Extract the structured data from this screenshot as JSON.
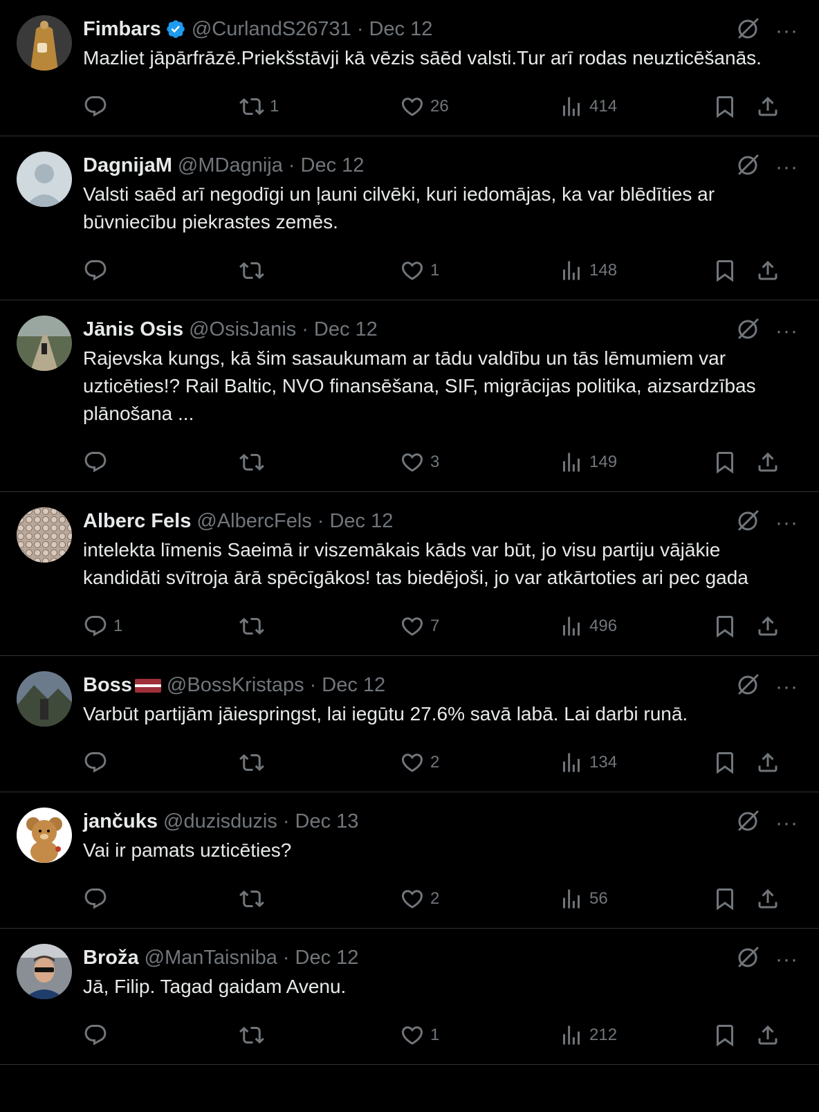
{
  "tweets": [
    {
      "name": "Fimbars",
      "verified": true,
      "flag": false,
      "handle": "@CurlandS26731",
      "date": "Dec 12",
      "text": "Mazliet jāpārfrāzē.Priekšstāvji kā vēzis sāēd valsti.Tur arī rodas neuzticēšanās.",
      "replies": "",
      "retweets": "1",
      "likes": "26",
      "views": "414",
      "avatar": "fimbars"
    },
    {
      "name": "DagnijaM",
      "verified": false,
      "flag": false,
      "handle": "@MDagnija",
      "date": "Dec 12",
      "text": "Valsti saēd arī negodīgi un ļauni cilvēki, kuri iedomājas, ka var blēdīties ar būvniecību piekrastes zemēs.",
      "replies": "",
      "retweets": "",
      "likes": "1",
      "views": "148",
      "avatar": "default"
    },
    {
      "name": "Jānis Osis",
      "verified": false,
      "flag": false,
      "handle": "@OsisJanis",
      "date": "Dec 12",
      "text": "Rajevska kungs, kā šim sasaukumam ar tādu valdību un tās lēmumiem var uzticēties!? Rail Baltic, NVO finansēšana, SIF, migrācijas politika, aizsardzības plānošana ...",
      "replies": "",
      "retweets": "",
      "likes": "3",
      "views": "149",
      "avatar": "road"
    },
    {
      "name": "Alberc Fels",
      "verified": false,
      "flag": false,
      "handle": "@AlbercFels",
      "date": "Dec 12",
      "text": "intelekta līmenis Saeimā ir viszemākais kāds var būt, jo visu partiju vājākie kandidāti svītroja ārā spēcīgākos! tas biedējoši, jo var atkārtoties ari pec gada",
      "replies": "1",
      "retweets": "",
      "likes": "7",
      "views": "496",
      "avatar": "tiles"
    },
    {
      "name": "Boss",
      "verified": false,
      "flag": true,
      "handle": "@BossKristaps",
      "date": "Dec 12",
      "text": "Varbūt partijām jāiespringst, lai iegūtu 27.6% savā labā. Lai darbi runā.",
      "replies": "",
      "retweets": "",
      "likes": "2",
      "views": "134",
      "avatar": "mountain"
    },
    {
      "name": "jančuks",
      "verified": false,
      "flag": false,
      "handle": "@duzisduzis",
      "date": "Dec 13",
      "text": "Vai ir pamats uzticēties?",
      "replies": "",
      "retweets": "",
      "likes": "2",
      "views": "56",
      "avatar": "teddy"
    },
    {
      "name": "Broža",
      "verified": false,
      "flag": false,
      "handle": "@ManTaisniba",
      "date": "Dec 12",
      "text": "Jā, Filip. Tagad gaidam Avenu.",
      "replies": "",
      "retweets": "",
      "likes": "1",
      "views": "212",
      "avatar": "man"
    }
  ],
  "separator": "·",
  "more_label": "···",
  "colors": {
    "background": "#000000",
    "text": "#e7e9ea",
    "muted": "#71767b",
    "border": "#2f3336",
    "verified": "#1d9bf0"
  }
}
